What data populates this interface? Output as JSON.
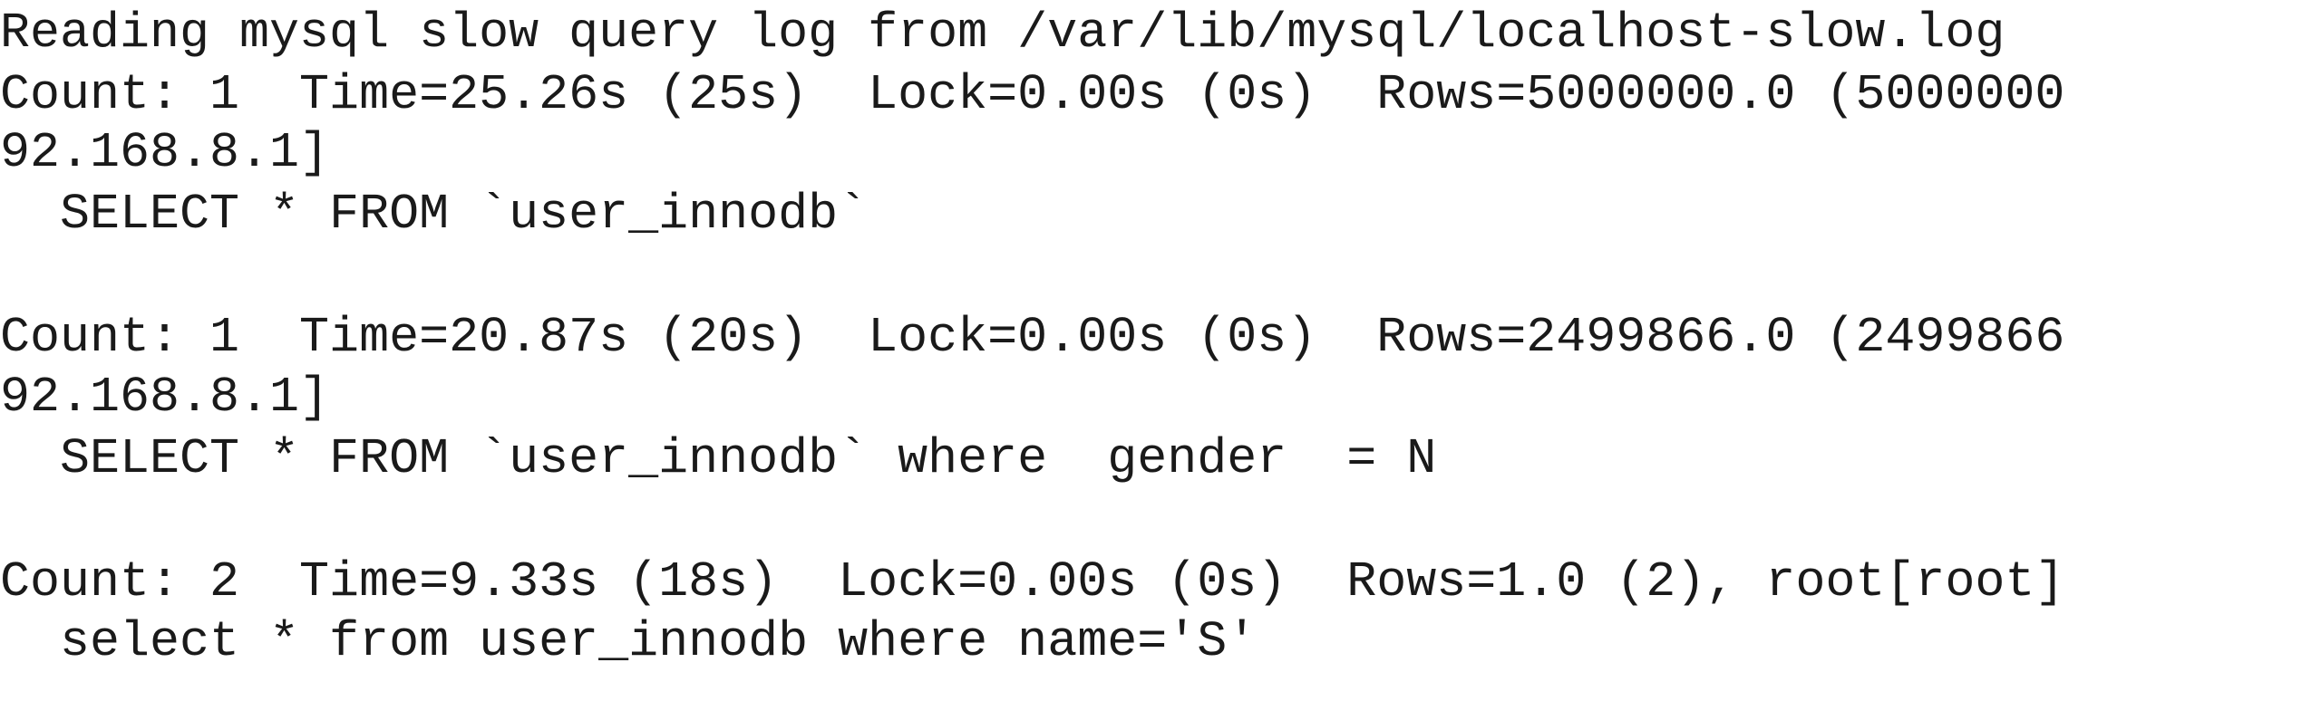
{
  "terminal": {
    "lines": [
      "Reading mysql slow query log from /var/lib/mysql/localhost-slow.log",
      "Count: 1  Time=25.26s (25s)  Lock=0.00s (0s)  Rows=5000000.0 (5000000",
      "92.168.8.1]",
      "  SELECT * FROM `user_innodb`",
      "Count: 1  Time=20.87s (20s)  Lock=0.00s (0s)  Rows=2499866.0 (2499866",
      "92.168.8.1]",
      "  SELECT * FROM `user_innodb` where  gender  = N",
      "Count: 2  Time=9.33s (18s)  Lock=0.00s (0s)  Rows=1.0 (2), root[root]",
      "  select * from user_innodb where name='S'"
    ]
  }
}
